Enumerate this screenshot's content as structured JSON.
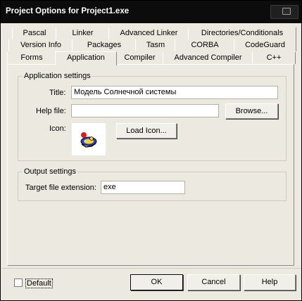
{
  "window": {
    "title": "Project Options for Project1.exe"
  },
  "tabs": {
    "row1": [
      "Pascal",
      "Linker",
      "Advanced Linker",
      "Directories/Conditionals"
    ],
    "row2": [
      "Version Info",
      "Packages",
      "Tasm",
      "CORBA",
      "CodeGuard"
    ],
    "row3": [
      "Forms",
      "Application",
      "Compiler",
      "Advanced Compiler",
      "C++"
    ],
    "selected": "Application"
  },
  "app_settings": {
    "group_title": "Application settings",
    "title_label": "Title:",
    "title_value": "Модель Солнечной системы",
    "helpfile_label": "Help file:",
    "helpfile_value": "",
    "browse_button": "Browse...",
    "icon_label": "Icon:",
    "load_icon_button": "Load Icon..."
  },
  "output_settings": {
    "group_title": "Output settings",
    "ext_label": "Target file extension:",
    "ext_value": "exe"
  },
  "footer": {
    "default_label": "Default",
    "default_checked": false,
    "ok_button": "OK",
    "cancel_button": "Cancel",
    "help_button": "Help"
  }
}
